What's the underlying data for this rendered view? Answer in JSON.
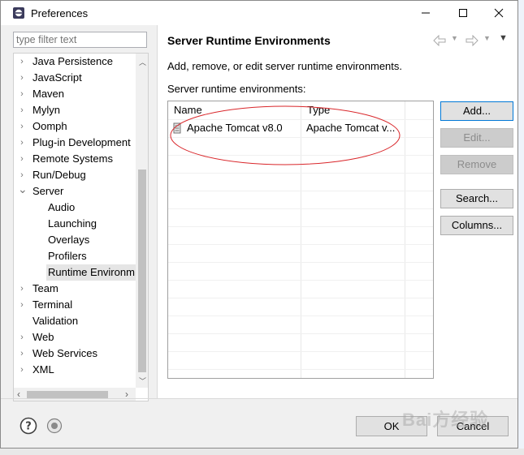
{
  "window": {
    "title": "Preferences",
    "minimize_icon": "minimize-icon",
    "maximize_icon": "maximize-icon",
    "close_icon": "close-icon"
  },
  "filter": {
    "placeholder": "type filter text",
    "value": ""
  },
  "tree": {
    "items": [
      {
        "label": "Java Persistence",
        "expanded": false
      },
      {
        "label": "JavaScript",
        "expanded": false
      },
      {
        "label": "Maven",
        "expanded": false
      },
      {
        "label": "Mylyn",
        "expanded": false
      },
      {
        "label": "Oomph",
        "expanded": false
      },
      {
        "label": "Plug-in Development",
        "expanded": false
      },
      {
        "label": "Remote Systems",
        "expanded": false
      },
      {
        "label": "Run/Debug",
        "expanded": false
      },
      {
        "label": "Server",
        "expanded": true
      },
      {
        "label": "Team",
        "expanded": false
      },
      {
        "label": "Terminal",
        "expanded": false
      },
      {
        "label": "Validation",
        "expanded": null
      },
      {
        "label": "Web",
        "expanded": false
      },
      {
        "label": "Web Services",
        "expanded": false
      },
      {
        "label": "XML",
        "expanded": false
      }
    ],
    "server_children": [
      {
        "label": "Audio"
      },
      {
        "label": "Launching"
      },
      {
        "label": "Overlays"
      },
      {
        "label": "Profilers"
      },
      {
        "label": "Runtime Environm",
        "selected": true
      }
    ]
  },
  "page": {
    "title": "Server Runtime Environments",
    "description": "Add, remove, or edit server runtime environments.",
    "list_label": "Server runtime environments:",
    "nav_icons": [
      "back-arrow-icon",
      "forward-arrow-icon",
      "view-menu-icon"
    ]
  },
  "table": {
    "columns": [
      "Name",
      "Type"
    ],
    "rows": [
      {
        "name": "Apache Tomcat v8.0",
        "type": "Apache Tomcat v..."
      }
    ],
    "highlight_color": "#d9262a"
  },
  "buttons": {
    "add": "Add...",
    "edit": "Edit...",
    "remove": "Remove",
    "search": "Search...",
    "columns": "Columns..."
  },
  "footer": {
    "help_icon": "help-icon",
    "import_icon": "import-export-icon",
    "ok": "OK",
    "cancel": "Cancel"
  },
  "watermark": "Bai方经验"
}
